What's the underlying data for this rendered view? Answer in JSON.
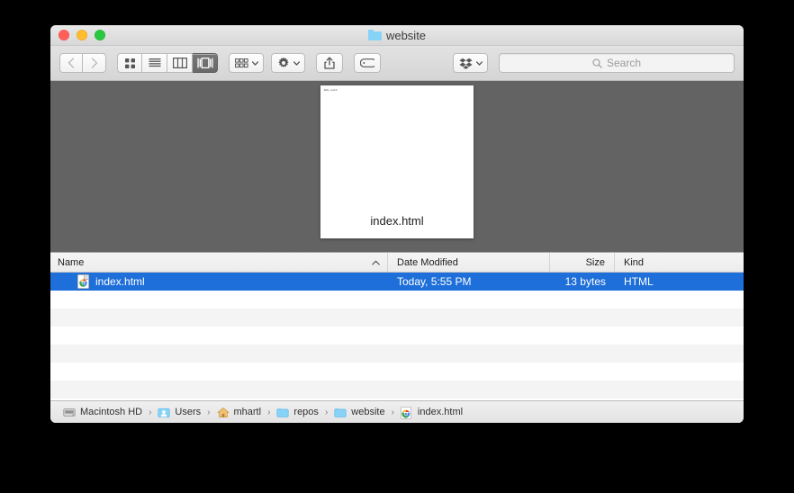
{
  "window": {
    "title": "website",
    "title_icon": "folder-icon",
    "traffic_lights": {
      "close_label": "close",
      "minimize_label": "minimize",
      "zoom_label": "zoom",
      "close_color": "#ff5f57",
      "minimize_color": "#febc2e",
      "zoom_color": "#28c840"
    }
  },
  "toolbar": {
    "back_label": "Back",
    "forward_label": "Forward",
    "view_icon_label": "Icon View",
    "view_list_label": "List View",
    "view_column_label": "Column View",
    "view_coverflow_label": "Cover Flow View",
    "active_view": "Cover Flow View",
    "arrange_label": "Arrange",
    "action_label": "Action",
    "share_label": "Share",
    "tags_label": "Tags",
    "dropbox_label": "Dropbox"
  },
  "search": {
    "placeholder": "Search",
    "value": "",
    "icon": "search-icon"
  },
  "preview": {
    "tiny_text": "hello, world!",
    "filename": "index.html"
  },
  "columns": [
    {
      "label": "Name",
      "sort": "ascending"
    },
    {
      "label": "Date Modified",
      "sort": ""
    },
    {
      "label": "Size",
      "sort": ""
    },
    {
      "label": "Kind",
      "sort": ""
    }
  ],
  "files": [
    {
      "name": "index.html",
      "date_modified": "Today, 5:55 PM",
      "size": "13 bytes",
      "kind": "HTML",
      "icon": "html-document-icon",
      "selected": true
    }
  ],
  "selection_color": "#1e6fd9",
  "pathbar": [
    {
      "label": "Macintosh HD",
      "icon": "hard-drive-icon"
    },
    {
      "label": "Users",
      "icon": "users-folder-icon"
    },
    {
      "label": "mhartl",
      "icon": "home-folder-icon"
    },
    {
      "label": "repos",
      "icon": "folder-icon"
    },
    {
      "label": "website",
      "icon": "folder-icon"
    },
    {
      "label": "index.html",
      "icon": "html-document-icon"
    }
  ],
  "path_separator": "›"
}
